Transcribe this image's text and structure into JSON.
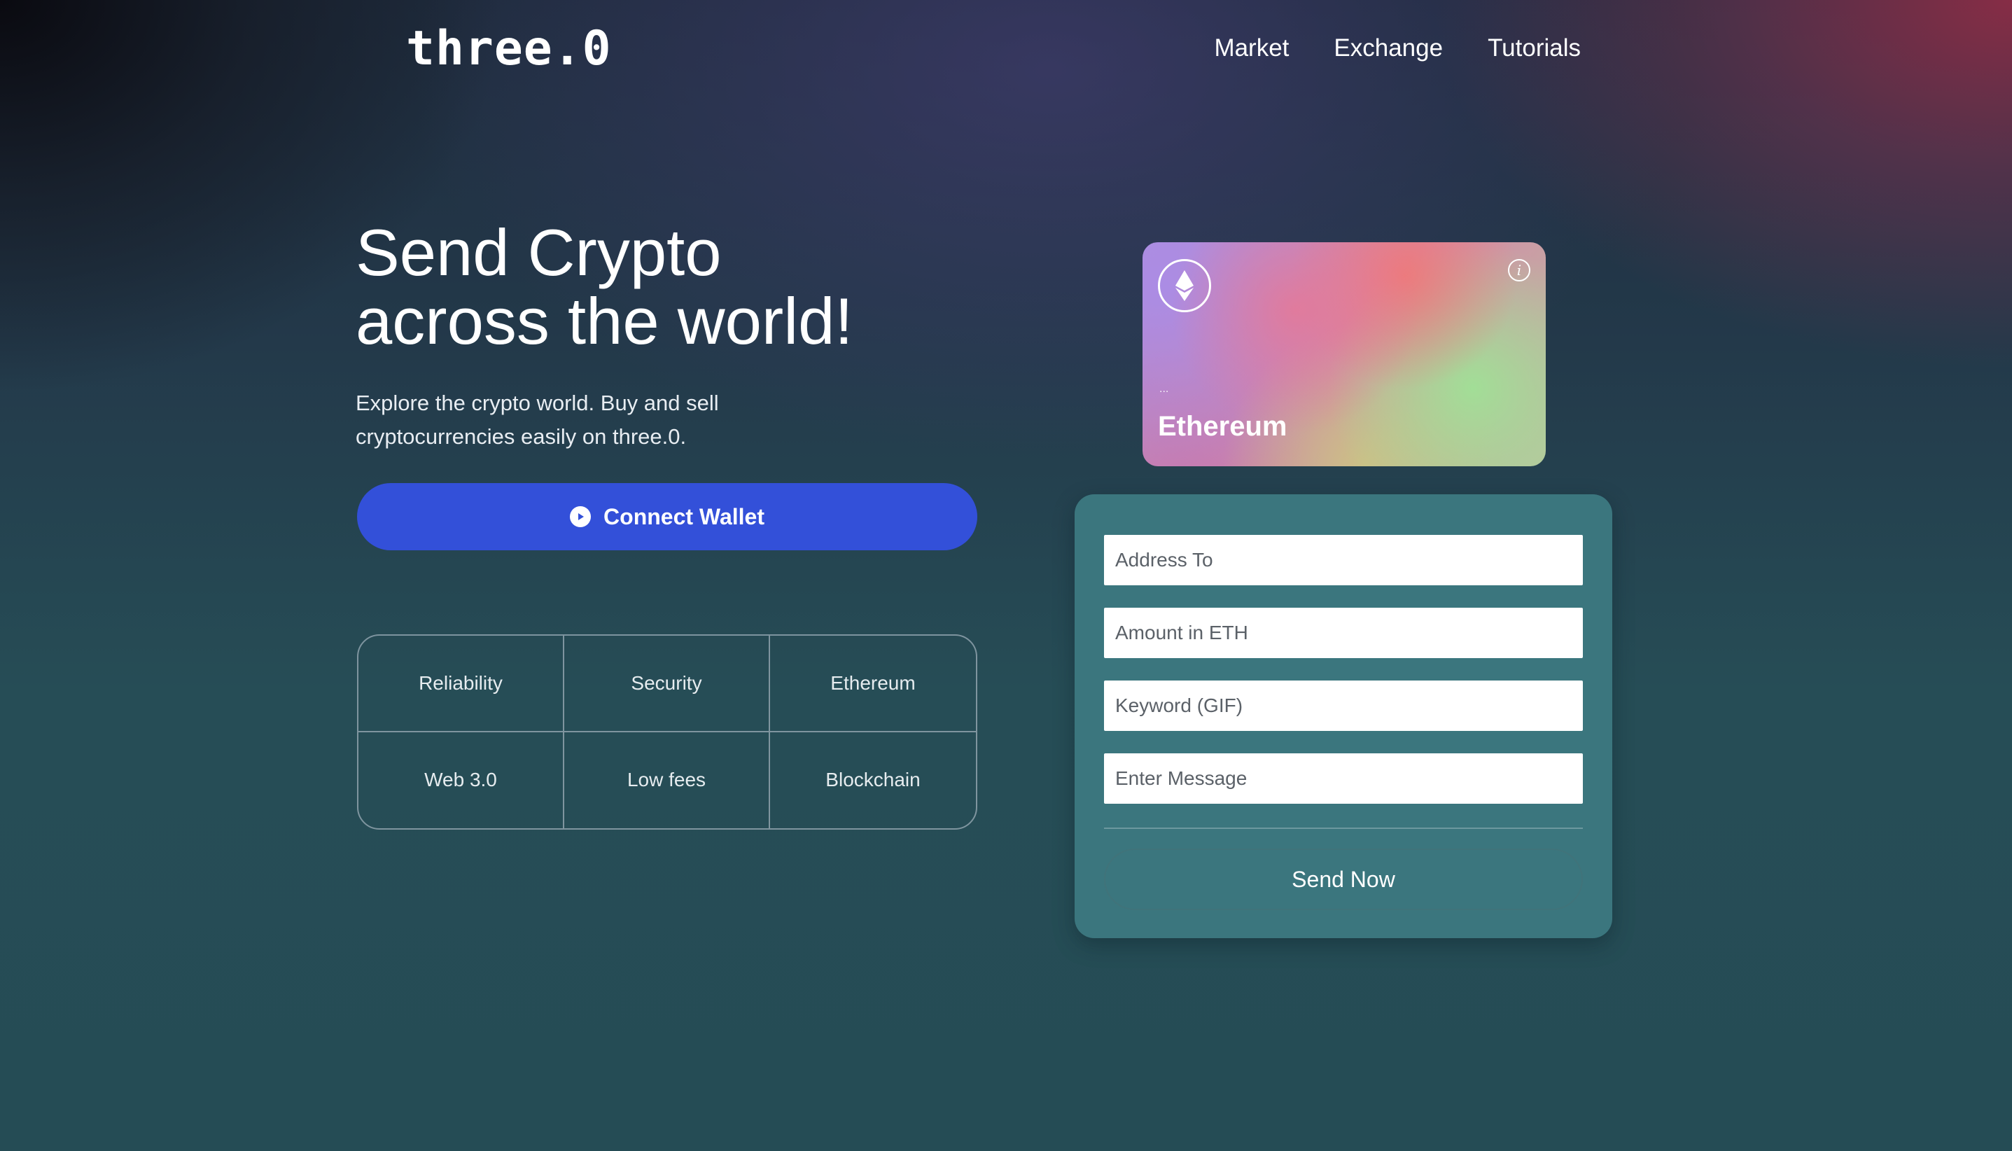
{
  "header": {
    "logo_text": "three.0",
    "nav": [
      "Market",
      "Exchange",
      "Tutorials"
    ]
  },
  "hero": {
    "title_line1": "Send Crypto",
    "title_line2": "across the world!",
    "subtitle": "Explore the crypto world. Buy and sell cryptocurrencies easily on three.0.",
    "connect_button_label": "Connect Wallet"
  },
  "features": [
    "Reliability",
    "Security",
    "Ethereum",
    "Web 3.0",
    "Low fees",
    "Blockchain"
  ],
  "eth_card": {
    "address_text": "...",
    "name": "Ethereum"
  },
  "send_form": {
    "address_placeholder": "Address To",
    "amount_placeholder": "Amount in ETH",
    "keyword_placeholder": "Keyword (GIF)",
    "message_placeholder": "Enter Message",
    "send_button_label": "Send Now"
  },
  "colors": {
    "accent_button": "#3350d9",
    "form_panel": "#3b767e",
    "background_bottom": "#264d56"
  },
  "icons": {
    "connect_button": "play-circle-icon",
    "card_logo": "ethereum-icon",
    "card_info": "info-icon"
  }
}
